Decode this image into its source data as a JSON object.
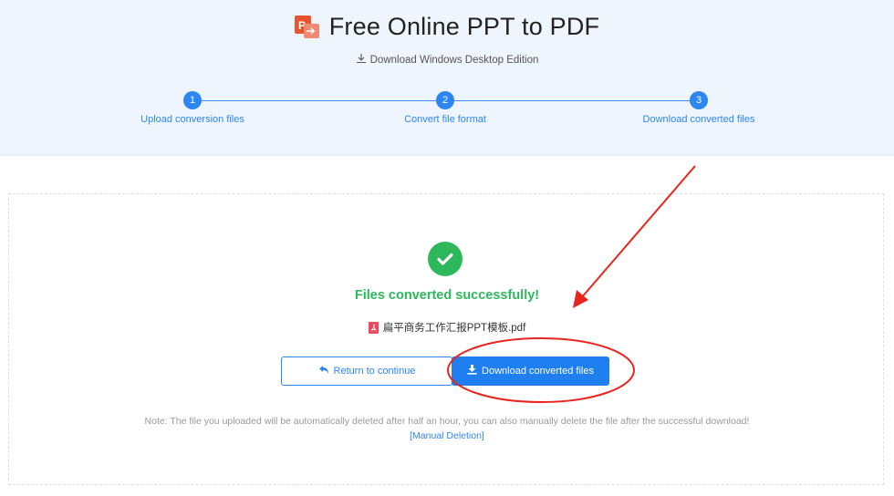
{
  "header": {
    "title": "Free Online PPT to PDF",
    "desktop_link": "Download Windows Desktop Edition",
    "logo_icon": "ppt-to-pdf-logo-icon"
  },
  "steps": [
    {
      "number": "1",
      "label": "Upload conversion files"
    },
    {
      "number": "2",
      "label": "Convert file format"
    },
    {
      "number": "3",
      "label": "Download converted files"
    }
  ],
  "result": {
    "status": "Files converted successfully!",
    "file_name": "扁平商务工作汇报PPT模板.pdf",
    "file_icon": "pdf-file-icon"
  },
  "buttons": {
    "return_label": "Return to continue",
    "download_label": "Download converted files"
  },
  "note": {
    "text": "Note: The file you uploaded will be automatically deleted after half an hour, you can also manually delete the file after the successful download!",
    "manual_deletion": "[Manual Deletion]"
  },
  "colors": {
    "accent": "#2d86f2",
    "success": "#2eb85c",
    "header_bg": "#eef5fd",
    "annotation": "#e8251f"
  }
}
